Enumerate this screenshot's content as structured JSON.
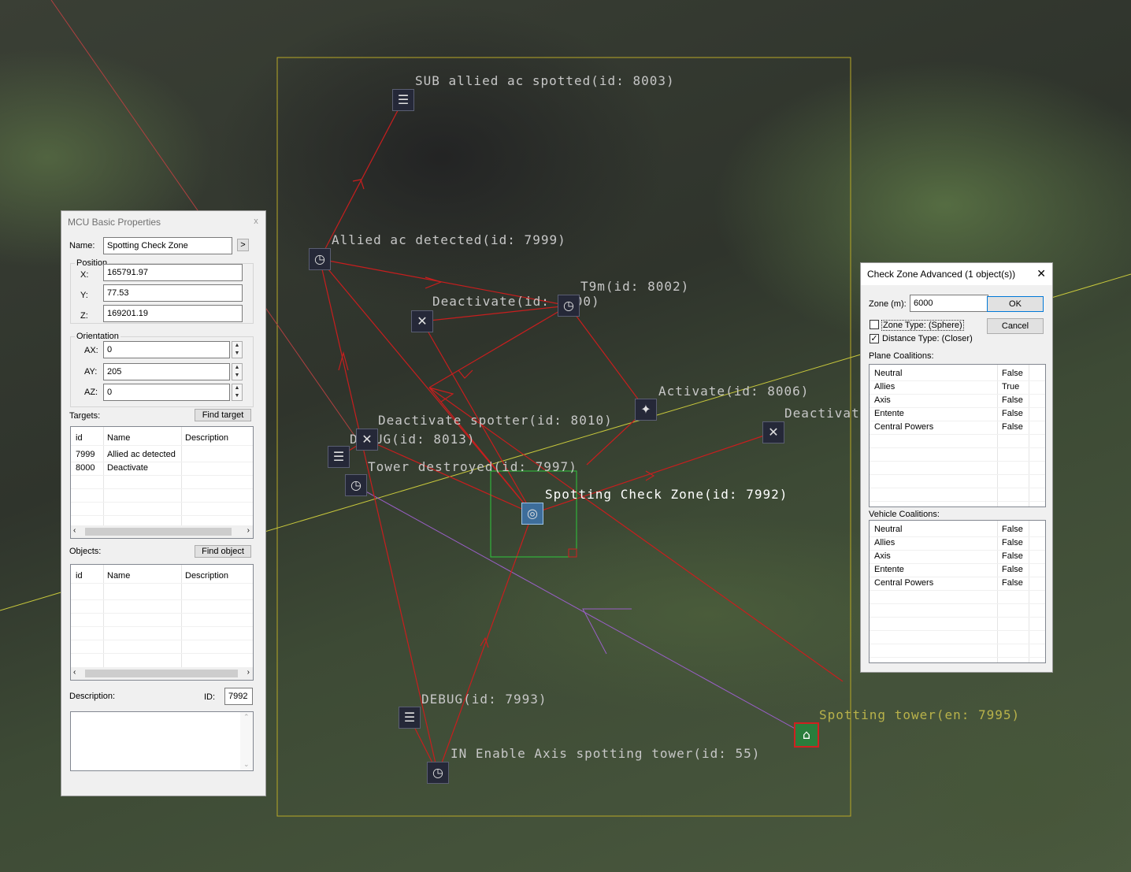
{
  "map": {
    "labels": [
      {
        "text": "SUB allied ac spotted(id: 8003)"
      },
      {
        "text": "Allied ac detected(id: 7999)"
      },
      {
        "text": "Deactivate(id: 8000)"
      },
      {
        "text": "T9m(id: 8002)"
      },
      {
        "text": "Activate(id: 8006)"
      },
      {
        "text": "Deactivate"
      },
      {
        "text": "Deactivate spotter(id: 8010)"
      },
      {
        "text": "DEBUG(id: 8013)"
      },
      {
        "text": "Tower destroyed(id: 7997)"
      },
      {
        "text": "Spotting Check Zone(id: 7992)"
      },
      {
        "text": "DEBUG(id: 7993)"
      },
      {
        "text": "IN Enable Axis spotting tower(id: 55)"
      },
      {
        "text": "Spotting tower(en: 7995)"
      }
    ],
    "icons": {
      "timer": "clock-icon",
      "subtitle": "lines-icon",
      "deactivate": "deactivate-icon",
      "activate": "activate-icon",
      "checkzone": "checkzone-icon",
      "tower": "house-icon"
    },
    "colors": {
      "link": "#c81e1e",
      "zone_box": "#b8a826",
      "selection": "#2ec83c",
      "purple_link": "#9a5fc8",
      "yellow_line": "#c8c83c"
    }
  },
  "mcu": {
    "title": "MCU Basic Properties",
    "close": "x",
    "name_label": "Name:",
    "name_value": "Spotting Check Zone",
    "arrow_btn": ">",
    "position_label": "Position",
    "x_label": "X:",
    "x_value": "165791.97",
    "y_label": "Y:",
    "y_value": "77.53",
    "z_label": "Z:",
    "z_value": "169201.19",
    "orientation_label": "Orientation",
    "ax_label": "AX:",
    "ax_value": "0",
    "ay_label": "AY:",
    "ay_value": "205",
    "az_label": "AZ:",
    "az_value": "0",
    "targets_label": "Targets:",
    "find_target": "Find target",
    "targets_headers": [
      "id",
      "Name",
      "Description"
    ],
    "targets_rows": [
      {
        "id": "7999",
        "name": "Allied ac detected",
        "desc": ""
      },
      {
        "id": "8000",
        "name": "Deactivate",
        "desc": ""
      }
    ],
    "objects_label": "Objects:",
    "find_object": "Find object",
    "objects_headers": [
      "id",
      "Name",
      "Description"
    ],
    "description_label": "Description:",
    "id_label": "ID:",
    "id_value": "7992"
  },
  "czone": {
    "title": "Check Zone Advanced (1 object(s))",
    "close": "✕",
    "zone_label": "Zone (m):",
    "zone_value": "6000",
    "ok": "OK",
    "cancel": "Cancel",
    "zone_type": "Zone Type: (Sphere)",
    "zone_type_checked": false,
    "distance_type": "Distance Type: (Closer)",
    "distance_type_checked": true,
    "plane_label": "Plane Coalitions:",
    "plane_rows": [
      {
        "name": "Neutral",
        "value": "False"
      },
      {
        "name": "Allies",
        "value": "True"
      },
      {
        "name": "Axis",
        "value": "False"
      },
      {
        "name": "Entente",
        "value": "False"
      },
      {
        "name": "Central Powers",
        "value": "False"
      }
    ],
    "vehicle_label": "Vehicle Coalitions:",
    "vehicle_rows": [
      {
        "name": "Neutral",
        "value": "False"
      },
      {
        "name": "Allies",
        "value": "False"
      },
      {
        "name": "Axis",
        "value": "False"
      },
      {
        "name": "Entente",
        "value": "False"
      },
      {
        "name": "Central Powers",
        "value": "False"
      }
    ]
  }
}
